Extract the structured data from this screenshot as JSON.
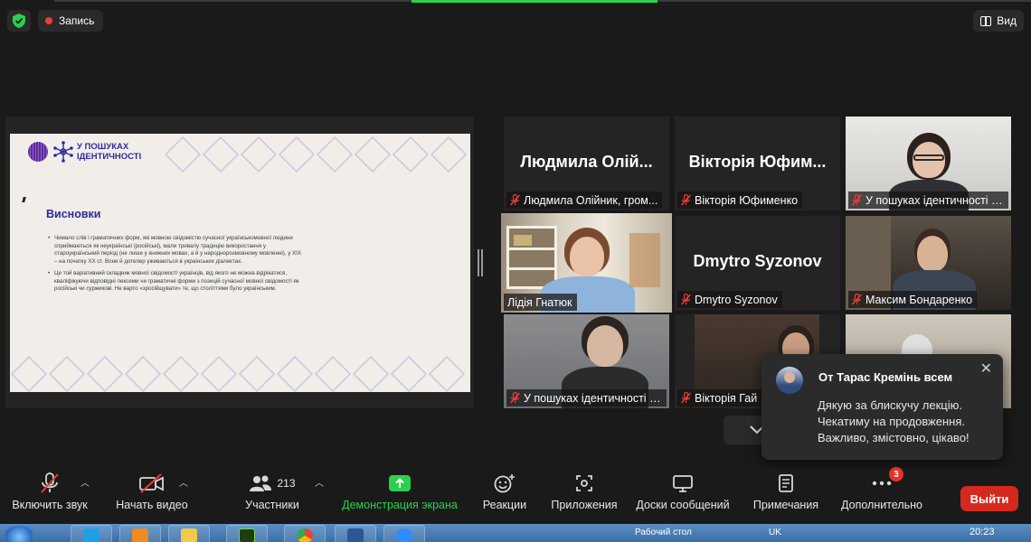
{
  "top": {
    "record_label": "Запись",
    "view_label": "Вид"
  },
  "slide": {
    "logo_line1": "У ПОШУКАХ",
    "logo_line2": "ІДЕНТИЧНОСТІ",
    "title": "Висновки",
    "bullets": [
      "Чимало слів і граматичних форм, які мовною свідомістю сучасної українськомовної людини сприймаються як неукраїнські (російські), мали тривалу традицію використання у староукраїнський період (не лише у книжних мовах, а й у народнорозмовному мовленні), у ХІХ – на початку ХХ ст. Вони й дотепер уживаються в українських діалектах.",
      "Це той варіативний складник мовної свідомості українців, від якого не можна відрікатися, кваліфікуючи відповідні лексеми чи граматичні форми з позицій сучасної мовної свідомості як російські чи суржикові. Не варто «зросійщувати» те, що століттями було українським."
    ]
  },
  "tiles": [
    {
      "big_name": "Людмила Олій...",
      "label": "Людмила Олійник, гром..."
    },
    {
      "big_name": "Вікторія Юфим...",
      "label": "Вікторія Юфименко"
    },
    {
      "big_name": "",
      "label": "У пошуках ідентичності (..."
    },
    {
      "big_name": "",
      "label": "Лідія Гнатюк"
    },
    {
      "big_name": "Dmytro Syzonov",
      "label": "Dmytro Syzonov"
    },
    {
      "big_name": "",
      "label": "Максим Бондаренко"
    },
    {
      "big_name": "",
      "label": "У пошуках ідентичності (..."
    },
    {
      "big_name": "",
      "label": "Вікторія Гай"
    },
    {
      "big_name": "",
      "label": ""
    }
  ],
  "chat_toast": {
    "from": "От Тарас Кремінь всем",
    "lines": [
      "Дякую за блискучу лекцію.",
      "Чекатиму на продовження.",
      "Важливо, змістовно, цікаво!"
    ]
  },
  "toolbar": {
    "mute": "Включить звук",
    "video": "Начать видео",
    "participants": "Участники",
    "participants_count": "213",
    "share": "Демонстрация экрана",
    "reactions": "Реакции",
    "apps": "Приложения",
    "whiteboards": "Доски сообщений",
    "notes": "Примечания",
    "more": "Дополнительно",
    "more_badge": "3",
    "leave": "Выйти"
  },
  "taskbar": {
    "desktop_label": "Рабочий стол",
    "lang": "UK",
    "clock": "20:23"
  },
  "colors": {
    "accent_green": "#2bd14e",
    "leave_red": "#d5281f",
    "active_speaker": "#e7e24a",
    "slide_title": "#2b2a9a"
  }
}
